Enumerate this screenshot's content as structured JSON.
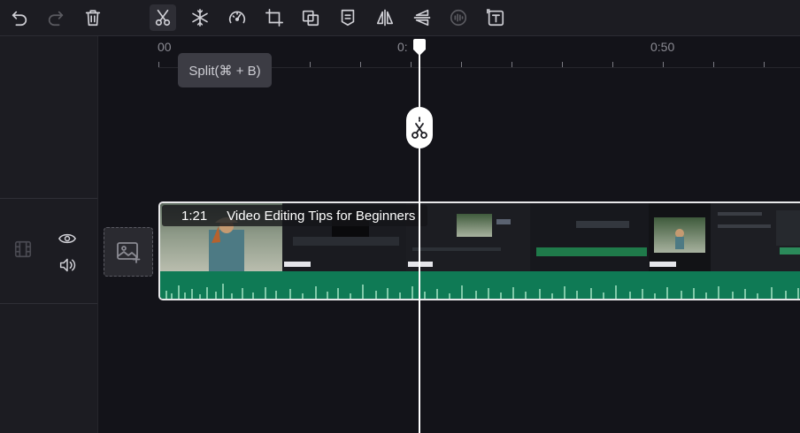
{
  "toolbar": {
    "tools": [
      {
        "name": "undo-icon"
      },
      {
        "name": "redo-icon"
      },
      {
        "name": "delete-icon"
      },
      {
        "name": "split-icon"
      },
      {
        "name": "freeze-icon"
      },
      {
        "name": "speed-icon"
      },
      {
        "name": "crop-icon"
      },
      {
        "name": "replace-icon"
      },
      {
        "name": "marker-icon"
      },
      {
        "name": "flip-horizontal-icon"
      },
      {
        "name": "flip-vertical-icon"
      },
      {
        "name": "audio-off-icon"
      },
      {
        "name": "text-icon"
      }
    ],
    "tooltip": "Split(⌘ + B)"
  },
  "ruler": {
    "labels": [
      "00",
      "0:",
      "0:50"
    ]
  },
  "clip": {
    "duration": "1:21",
    "title": "Video Editing Tips for Beginners"
  },
  "colors": {
    "background": "#131319",
    "panel": "#1c1c22",
    "audio_wave": "#0f7a55",
    "playhead": "#ffffff"
  }
}
